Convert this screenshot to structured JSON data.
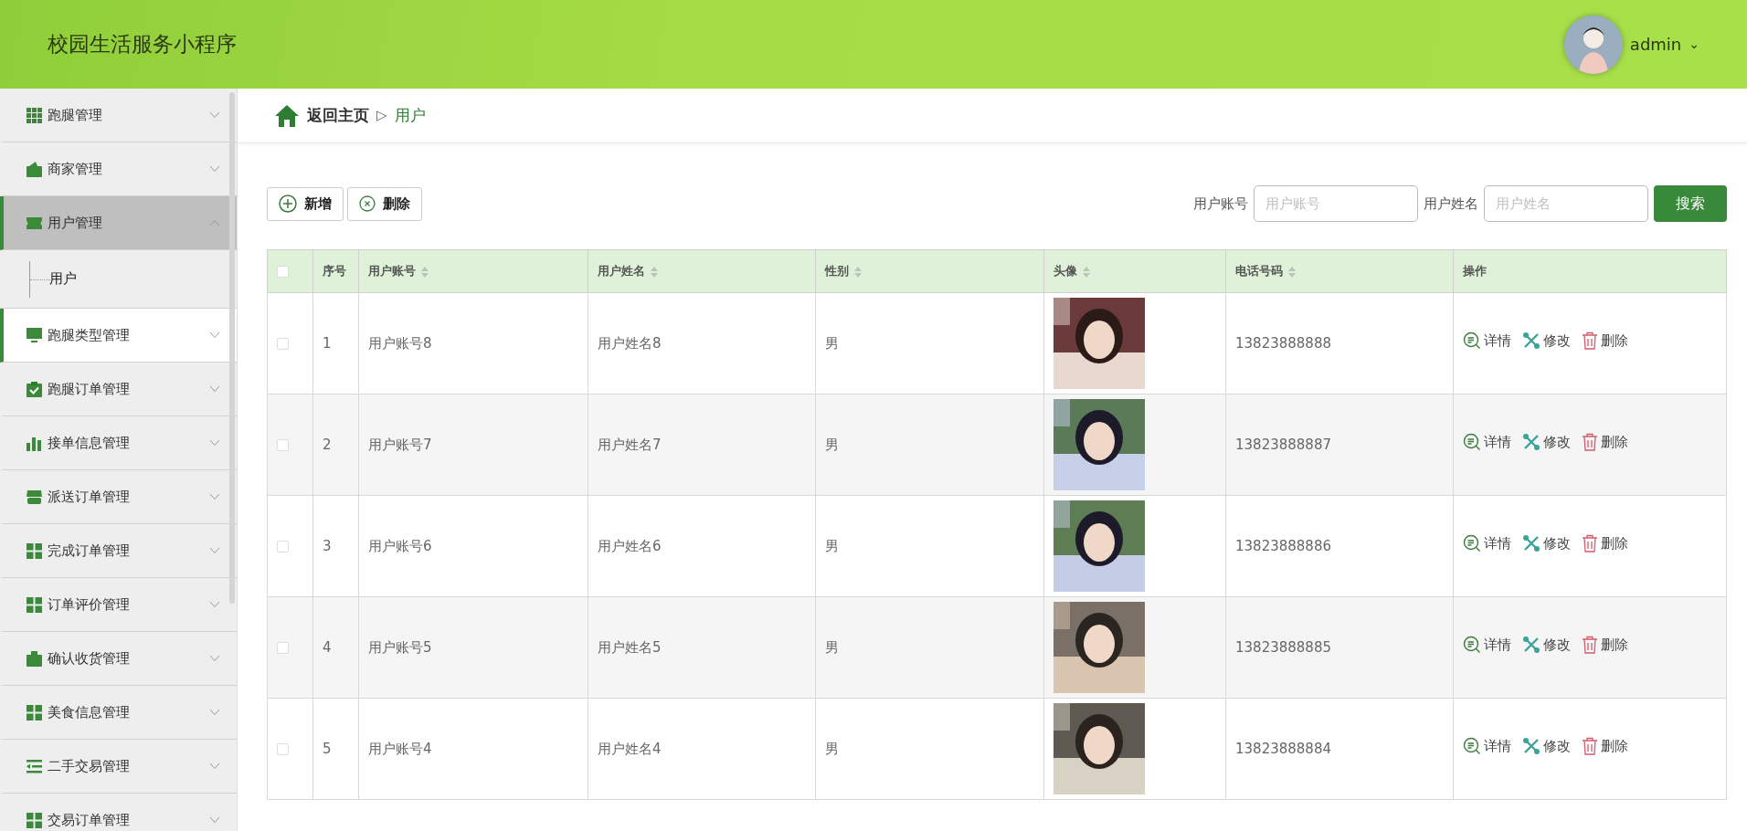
{
  "header": {
    "title": "校园生活服务小程序",
    "user": {
      "name": "admin",
      "caret": "⌄"
    }
  },
  "sidebar": {
    "items": [
      {
        "label": "跑腿管理",
        "expanded": false,
        "hovered": false
      },
      {
        "label": "商家管理",
        "expanded": false,
        "hovered": false
      },
      {
        "label": "用户管理",
        "expanded": true,
        "hovered": false,
        "children": [
          {
            "label": "用户"
          }
        ]
      },
      {
        "label": "跑腿类型管理",
        "expanded": false,
        "hovered": true
      },
      {
        "label": "跑腿订单管理",
        "expanded": false,
        "hovered": false
      },
      {
        "label": "接单信息管理",
        "expanded": false,
        "hovered": false
      },
      {
        "label": "派送订单管理",
        "expanded": false,
        "hovered": false
      },
      {
        "label": "完成订单管理",
        "expanded": false,
        "hovered": false
      },
      {
        "label": "订单评价管理",
        "expanded": false,
        "hovered": false
      },
      {
        "label": "确认收货管理",
        "expanded": false,
        "hovered": false
      },
      {
        "label": "美食信息管理",
        "expanded": false,
        "hovered": false
      },
      {
        "label": "二手交易管理",
        "expanded": false,
        "hovered": false
      },
      {
        "label": "交易订单管理",
        "expanded": false,
        "hovered": false
      }
    ]
  },
  "breadcrumb": {
    "home": "返回主页",
    "separator": "▷",
    "current": "用户"
  },
  "toolbar": {
    "buttons": [
      {
        "kind": "add",
        "label": "新增"
      },
      {
        "kind": "delete",
        "label": "删除"
      }
    ],
    "search": {
      "fields": [
        {
          "label": "用户账号",
          "placeholder": "用户账号"
        },
        {
          "label": "用户姓名",
          "placeholder": "用户姓名"
        }
      ],
      "button": "搜索"
    }
  },
  "table": {
    "select_all": {
      "checked": false
    },
    "columns": [
      {
        "label": "序号",
        "sortable": false
      },
      {
        "label": "用户账号",
        "sortable": true
      },
      {
        "label": "用户姓名",
        "sortable": true
      },
      {
        "label": "性别",
        "sortable": true
      },
      {
        "label": "头像",
        "sortable": true
      },
      {
        "label": "电话号码",
        "sortable": true
      },
      {
        "label": "操作",
        "sortable": false
      }
    ],
    "rows": [
      {
        "checked": false,
        "index": "1",
        "account": "用户账号8",
        "name": "用户姓名8",
        "gender": "男",
        "phone": "13823888888",
        "actions": [
          {
            "kind": "detail",
            "label": "详情"
          },
          {
            "kind": "edit",
            "label": "修改"
          },
          {
            "kind": "delete",
            "label": "删除"
          }
        ]
      },
      {
        "checked": false,
        "index": "2",
        "account": "用户账号7",
        "name": "用户姓名7",
        "gender": "男",
        "phone": "13823888887",
        "actions": [
          {
            "kind": "detail",
            "label": "详情"
          },
          {
            "kind": "edit",
            "label": "修改"
          },
          {
            "kind": "delete",
            "label": "删除"
          }
        ]
      },
      {
        "checked": false,
        "index": "3",
        "account": "用户账号6",
        "name": "用户姓名6",
        "gender": "男",
        "phone": "13823888886",
        "actions": [
          {
            "kind": "detail",
            "label": "详情"
          },
          {
            "kind": "edit",
            "label": "修改"
          },
          {
            "kind": "delete",
            "label": "删除"
          }
        ]
      },
      {
        "checked": false,
        "index": "4",
        "account": "用户账号5",
        "name": "用户姓名5",
        "gender": "男",
        "phone": "13823888885",
        "actions": [
          {
            "kind": "detail",
            "label": "详情"
          },
          {
            "kind": "edit",
            "label": "修改"
          },
          {
            "kind": "delete",
            "label": "删除"
          }
        ]
      },
      {
        "checked": false,
        "index": "5",
        "account": "用户账号4",
        "name": "用户姓名4",
        "gender": "男",
        "phone": "13823888884",
        "actions": [
          {
            "kind": "detail",
            "label": "详情"
          },
          {
            "kind": "edit",
            "label": "修改"
          },
          {
            "kind": "delete",
            "label": "删除"
          }
        ]
      }
    ]
  }
}
